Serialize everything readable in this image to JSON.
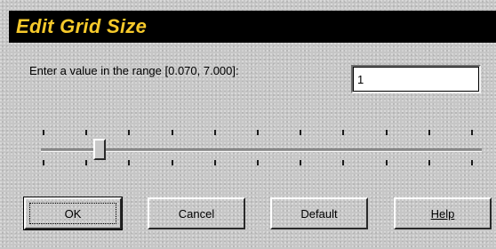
{
  "dialog": {
    "title": "Edit Grid Size",
    "prompt": "Enter a value in the range [0.070, 7.000]:",
    "value": "1"
  },
  "slider": {
    "min": 0.07,
    "max": 7.0,
    "value": 1,
    "tick_count": 11
  },
  "buttons": {
    "ok": "OK",
    "cancel": "Cancel",
    "default": "Default",
    "help": "Help"
  },
  "colors": {
    "title_bar": "#000000",
    "title_text": "#f6c92b",
    "dialog_face": "#c6c6c6"
  }
}
